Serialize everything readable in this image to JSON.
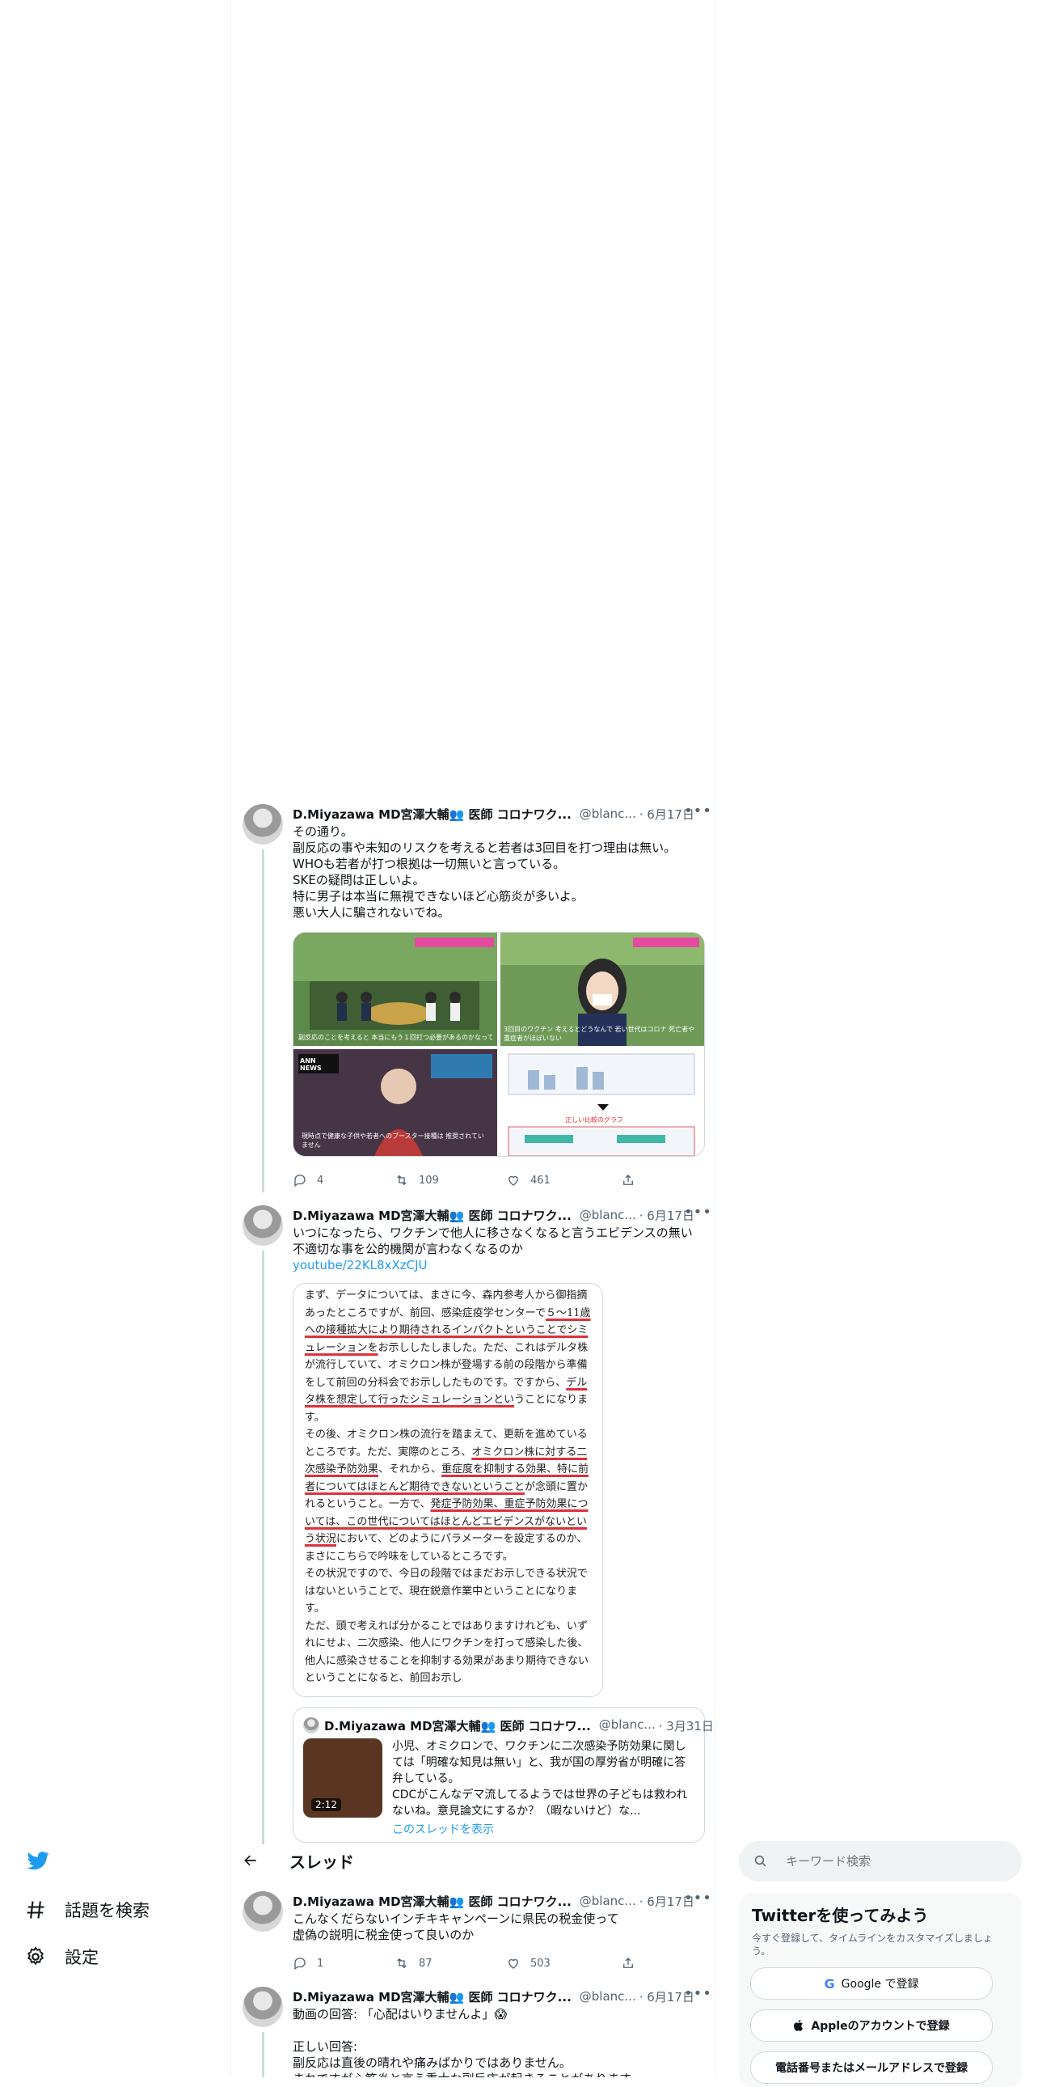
{
  "nav": {
    "explore_label": "話題を検索",
    "settings_label": "設定"
  },
  "header": {
    "title": "スレッド"
  },
  "search": {
    "placeholder": "キーワード検索"
  },
  "side": {
    "title": "Twitterを使ってみよう",
    "subtitle": "今すぐ登録して、タイムラインをカスタマイズしましょう。",
    "google_label": "Google で登録",
    "apple_label": "Appleのアカウントで登録",
    "phone_label": "電話番号またはメールアドレスで登録"
  },
  "author": {
    "name": "D.Miyazawa MD宮澤大輔👥 医師 コロナワク...",
    "handle": "@blanc...",
    "quote_name": "D.Miyazawa MD宮澤大輔👥 医師 コロナワ...",
    "quote_handle": "@blanc..."
  },
  "tweets": [
    {
      "date": "· 6月17日",
      "text": "その通り。\n副反応の事や未知のリスクを考えると若者は3回目を打つ理由は無い。\nWHOも若者が打つ根拠は一切無いと言っている。\nSKEの疑問は正しいよ。\n特に男子は本当に無視できないほど心筋炎が多いよ。\n悪い大人に騙されないでね。",
      "replies": "4",
      "retweets": "109",
      "likes": "461",
      "media": {
        "caption_1": "副反応のことを考えると 本当にもう１回打つ必要があるのかなって",
        "caption_2": "3回目のワクチン 考えるとどうなんで 若い世代はコロナ 死亡者や重症者がほぼいない",
        "news_logo": "ANN NEWS",
        "caption_3": "現時点で健康な子供や若者へのブースター接種は 推奨されていません",
        "graph_label": "正しい比較のグラフ"
      }
    },
    {
      "date": "· 6月17日",
      "text": "いつになったら、ワクチンで他人に移さなくなると言うエビデンスの無い不適切な事を公的機関が言わなくなるのか",
      "link": "youtube/22KL8xXzCJU",
      "doc_segments": [
        {
          "t": "まず、データについては、まさに今、森内参考人から御指摘あったところですが、前回、感染症疫学センターで",
          "u": false
        },
        {
          "t": "５～11歳への接種拡大により期待されるインパクトということでシミュレーションを",
          "u": true
        },
        {
          "t": "お示ししたしました。ただ、これはデルタ株が流行していて、オミクロン株が登場する前の段階から準備をして前回の分科会でお示ししたものです。ですから、",
          "u": false
        },
        {
          "t": "デルタ株を想定して行ったシミュレーションとい",
          "u": true
        },
        {
          "t": "うことになります。\nその後、オミクロン株の流行を踏まえて、更新を進めているところです。ただ、実際のところ、",
          "u": false
        },
        {
          "t": "オミクロン株に対する二次感染予防効果",
          "u": true
        },
        {
          "t": "、それから、",
          "u": false
        },
        {
          "t": "重症度を抑制する効果、特に前者についてはほとんど期待できないということ",
          "u": true
        },
        {
          "t": "が念頭に置かれるということ。一方で、",
          "u": false
        },
        {
          "t": "発症予防効果、重症予防効果については、この世代についてはほとんどエビデンスがないという状況",
          "u": true
        },
        {
          "t": "において、どのようにパラメーターを設定するのか、まさにこちらで吟味をしているところです。\nその状況ですので、今日の段階ではまだお示しできる状況ではないということで、現在鋭意作業中ということになります。\nただ、頭で考えれば分かることではありますけれども、いずれにせよ、二次感染、他人にワクチンを打って感染した後、他人に感染させることを抑制する効果があまり期待できないということになると、前回お示し",
          "u": false
        }
      ],
      "quote": {
        "date": "· 3月31日",
        "duration": "2:12",
        "text": "小児、オミクロンで、ワクチンに二次感染予防効果に関しては「明確な知見は無い」と、我が国の厚労省が明確に答弁している。\nCDCがこんなデマ流してるようでは世界の子どもは救われないね。意見論文にするか？（暇ないけど）な...",
        "thread_link": "このスレッドを表示"
      }
    },
    {
      "date": "· 6月17日",
      "text": "こんなくだらないインチキキャンペーンに県民の税金使って\n虚偽の説明に税金使って良いのか",
      "replies": "1",
      "retweets": "87",
      "likes": "503"
    },
    {
      "date": "· 6月17日",
      "text": "動画の回答: 「心配はいりませんよ」😱\n\n正しい回答:\n副反応は直後の晴れや痛みばかりではありません。\nまれですが心筋炎と言う重大な副反応が起きることがあります。"
    }
  ],
  "colors": {
    "accent": "#1d9bf0",
    "underline": "#e0303a"
  }
}
